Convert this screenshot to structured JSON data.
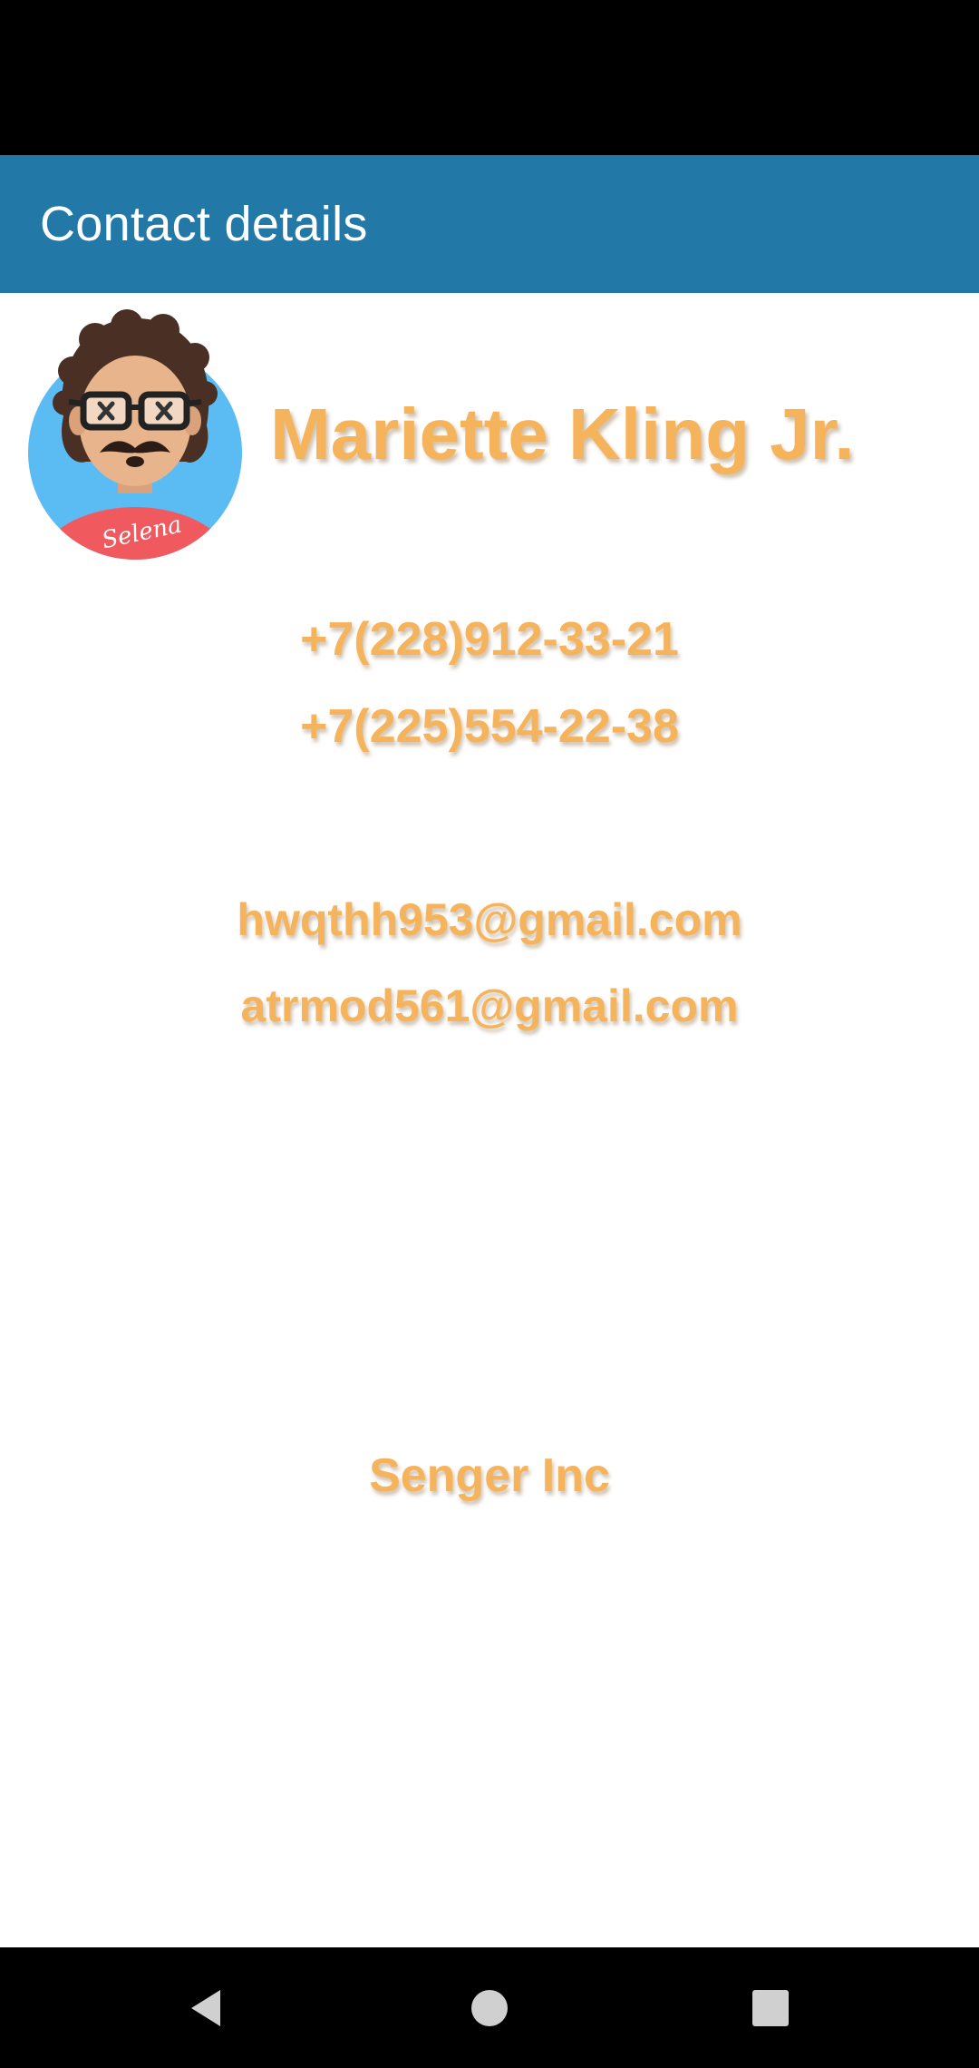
{
  "app_bar": {
    "title": "Contact details"
  },
  "contact": {
    "name": "Mariette Kling Jr.",
    "avatar_signature": "Selena",
    "phones": [
      "+7(228)912-33-21",
      "+7(225)554-22-38"
    ],
    "emails": [
      "hwqthh953@gmail.com",
      "atrmod561@gmail.com"
    ],
    "company": "Senger Inc"
  },
  "nav_bar": {
    "back_icon": "back-triangle-icon",
    "home_icon": "home-circle-icon",
    "recents_icon": "recents-square-icon"
  },
  "colors": {
    "app_bar": "#2278a7",
    "accent_text": "#f5b35c",
    "system_bars": "#000000"
  }
}
